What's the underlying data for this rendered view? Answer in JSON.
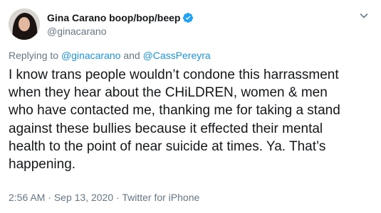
{
  "author": {
    "display_name": "Gina Carano boop/bop/beep",
    "handle": "@ginacarano",
    "verified": true,
    "avatar_icon": "avatar-photo"
  },
  "reply": {
    "prefix": "Replying to",
    "user1": "@ginacarano",
    "conjunction": "and",
    "user2": "@CassPereyra"
  },
  "tweet": {
    "text": "I know trans people wouldn’t condone this harrassment\nwhen they hear about the CHiLDREN, women & men\nwho have contacted me, thanking me for taking a stand\nagainst these bullies because it effected their mental\nhealth to the point of near suicide at times. Ya. That’s\nhappening."
  },
  "meta": {
    "time": "2:56 AM",
    "date": "Sep 13, 2020",
    "source": "Twitter for iPhone",
    "separator": "·"
  },
  "colors": {
    "text": "#14171a",
    "secondary": "#657786",
    "link": "#1b95e0",
    "verified": "#1da1f2"
  }
}
